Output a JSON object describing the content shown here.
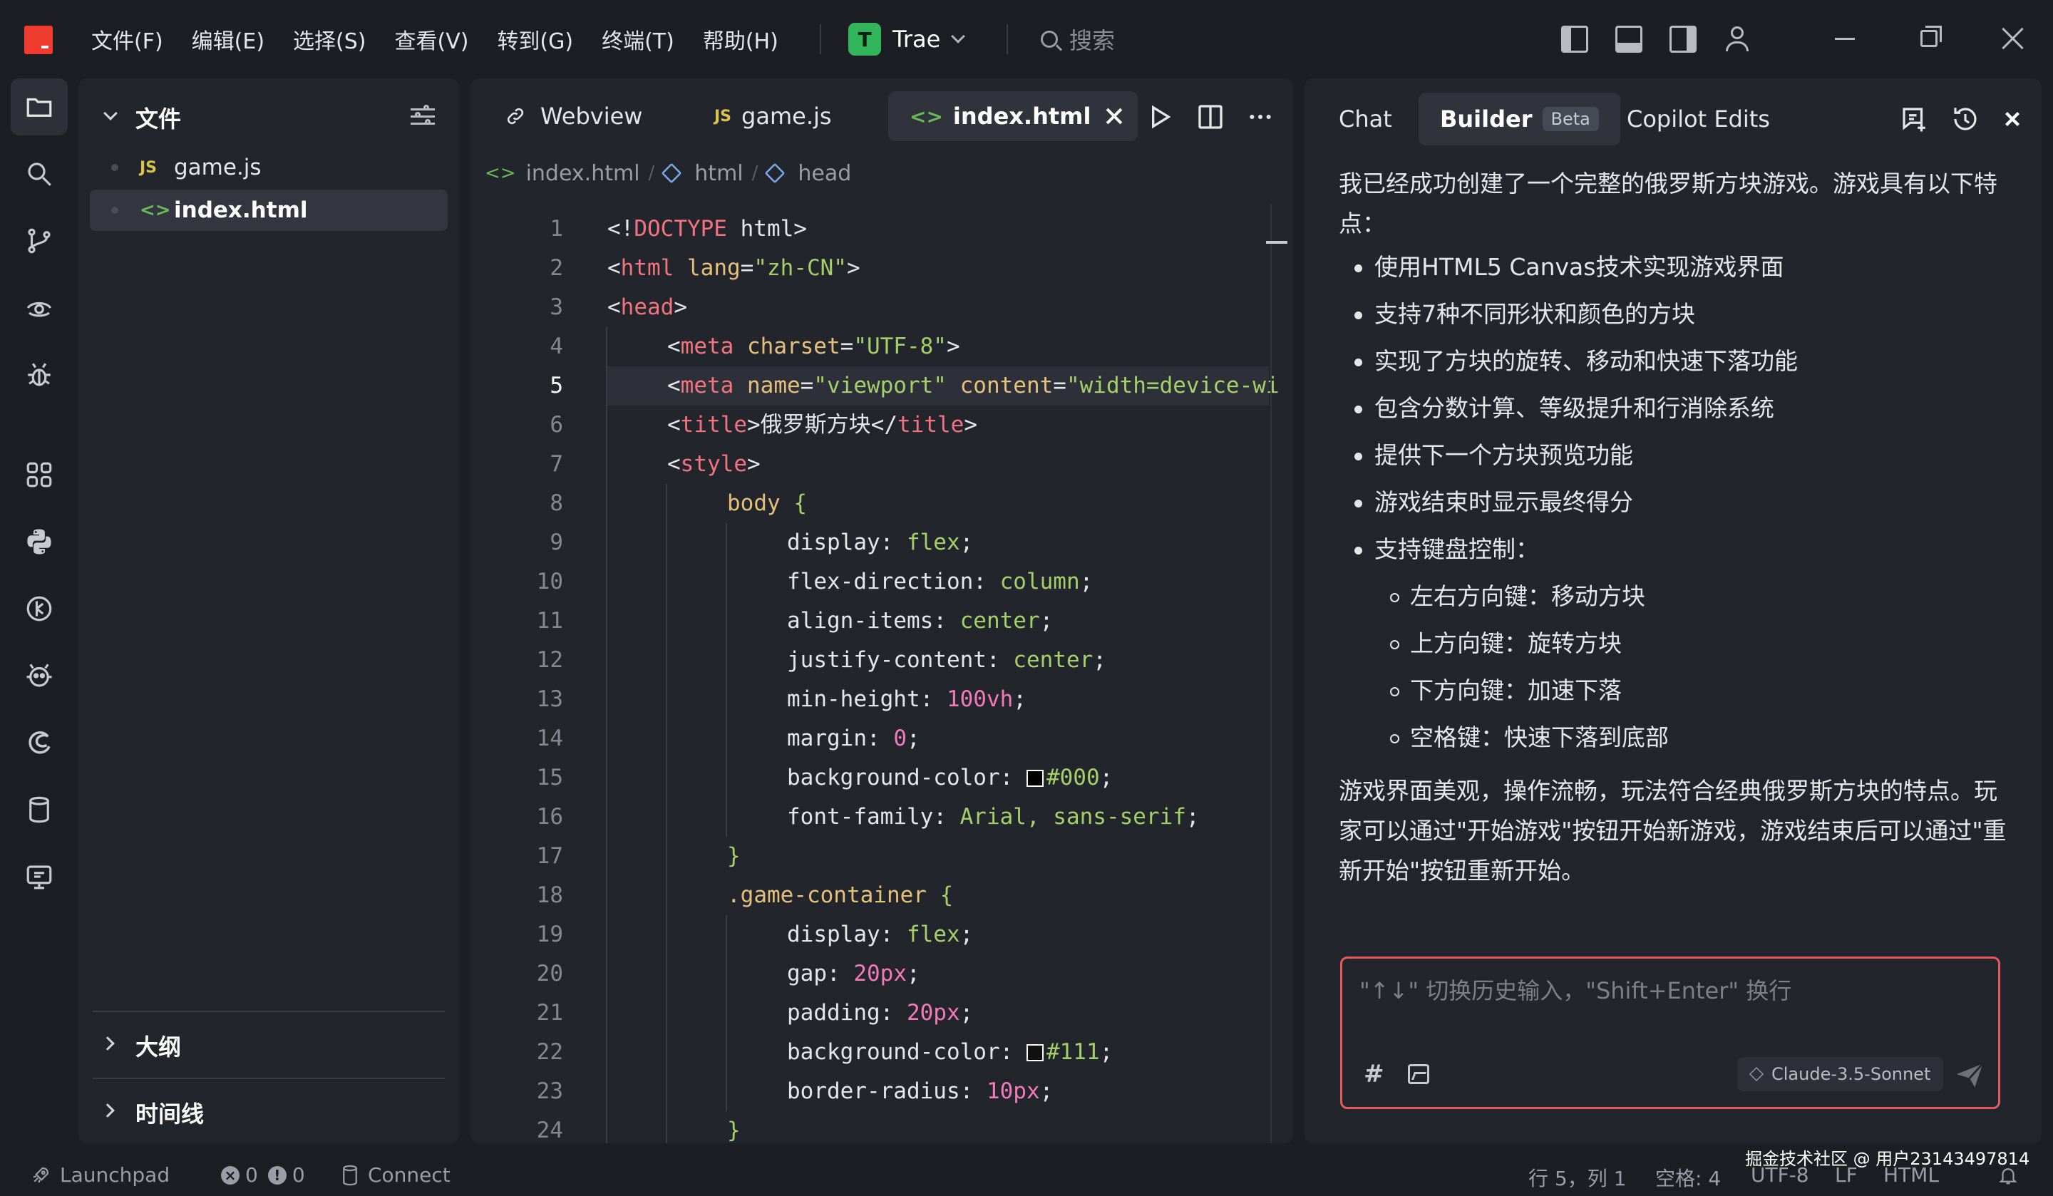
{
  "menus": [
    "文件(F)",
    "编辑(E)",
    "选择(S)",
    "查看(V)",
    "转到(G)",
    "终端(T)",
    "帮助(H)"
  ],
  "brand": {
    "badge": "T",
    "name": "Trae"
  },
  "search": {
    "label": "搜索"
  },
  "explorer": {
    "title": "文件",
    "files": [
      {
        "icon": "JS",
        "name": "game.js",
        "selected": false
      },
      {
        "icon": "<>",
        "name": "index.html",
        "selected": true
      }
    ],
    "sections": [
      "大纲",
      "时间线"
    ]
  },
  "editor": {
    "tabs": [
      {
        "label": "Webview",
        "icon": "webview-icon"
      },
      {
        "label": "game.js",
        "icon": "JS"
      },
      {
        "label": "index.html",
        "icon": "<>",
        "active": true
      }
    ],
    "breadcrumb": [
      "index.html",
      "html",
      "head"
    ],
    "current_line": 5,
    "lines": [
      {
        "n": "1",
        "d": 0,
        "s": [
          [
            "c-punc",
            "<!"
          ],
          [
            "c-tag",
            "DOCTYPE"
          ],
          [
            "c-punc",
            " html>"
          ]
        ]
      },
      {
        "n": "2",
        "d": 0,
        "s": [
          [
            "c-punc",
            "<"
          ],
          [
            "c-tag",
            "html"
          ],
          [
            "c-attr",
            " lang"
          ],
          [
            "c-punc",
            "="
          ],
          [
            "c-str",
            "\"zh-CN\""
          ],
          [
            "c-punc",
            ">"
          ]
        ]
      },
      {
        "n": "3",
        "d": 0,
        "s": [
          [
            "c-punc",
            "<"
          ],
          [
            "c-tag",
            "head"
          ],
          [
            "c-punc",
            ">"
          ]
        ]
      },
      {
        "n": "4",
        "d": 1,
        "s": [
          [
            "c-punc",
            "<"
          ],
          [
            "c-tag",
            "meta"
          ],
          [
            "c-attr",
            " charset"
          ],
          [
            "c-punc",
            "="
          ],
          [
            "c-str",
            "\"UTF-8\""
          ],
          [
            "c-punc",
            ">"
          ]
        ]
      },
      {
        "n": "5",
        "d": 1,
        "s": [
          [
            "c-punc",
            "<"
          ],
          [
            "c-tag",
            "meta"
          ],
          [
            "c-attr",
            " name"
          ],
          [
            "c-punc",
            "="
          ],
          [
            "c-str",
            "\"viewport\""
          ],
          [
            "c-attr",
            " content"
          ],
          [
            "c-punc",
            "="
          ],
          [
            "c-str",
            "\"width=device-wi"
          ]
        ]
      },
      {
        "n": "6",
        "d": 1,
        "s": [
          [
            "c-punc",
            "<"
          ],
          [
            "c-tag",
            "title"
          ],
          [
            "c-punc",
            ">"
          ],
          [
            "c-text",
            "俄罗斯方块"
          ],
          [
            "c-punc",
            "</"
          ],
          [
            "c-tag",
            "title"
          ],
          [
            "c-punc",
            ">"
          ]
        ]
      },
      {
        "n": "7",
        "d": 1,
        "s": [
          [
            "c-punc",
            "<"
          ],
          [
            "c-tag",
            "style"
          ],
          [
            "c-punc",
            ">"
          ]
        ]
      },
      {
        "n": "8",
        "d": 2,
        "s": [
          [
            "c-sel",
            "body"
          ],
          [
            "c-brace",
            " {"
          ]
        ]
      },
      {
        "n": "9",
        "d": 3,
        "s": [
          [
            "c-prop",
            "display"
          ],
          [
            "c-punc",
            ": "
          ],
          [
            "c-val",
            "flex"
          ],
          [
            "c-punc",
            ";"
          ]
        ]
      },
      {
        "n": "10",
        "d": 3,
        "s": [
          [
            "c-prop",
            "flex-direction"
          ],
          [
            "c-punc",
            ": "
          ],
          [
            "c-val",
            "column"
          ],
          [
            "c-punc",
            ";"
          ]
        ]
      },
      {
        "n": "11",
        "d": 3,
        "s": [
          [
            "c-prop",
            "align-items"
          ],
          [
            "c-punc",
            ": "
          ],
          [
            "c-val",
            "center"
          ],
          [
            "c-punc",
            ";"
          ]
        ]
      },
      {
        "n": "12",
        "d": 3,
        "s": [
          [
            "c-prop",
            "justify-content"
          ],
          [
            "c-punc",
            ": "
          ],
          [
            "c-val",
            "center"
          ],
          [
            "c-punc",
            ";"
          ]
        ]
      },
      {
        "n": "13",
        "d": 3,
        "s": [
          [
            "c-prop",
            "min-height"
          ],
          [
            "c-punc",
            ": "
          ],
          [
            "c-num",
            "100vh"
          ],
          [
            "c-punc",
            ";"
          ]
        ]
      },
      {
        "n": "14",
        "d": 3,
        "s": [
          [
            "c-prop",
            "margin"
          ],
          [
            "c-punc",
            ": "
          ],
          [
            "c-num",
            "0"
          ],
          [
            "c-punc",
            ";"
          ]
        ]
      },
      {
        "n": "15",
        "d": 3,
        "s": [
          [
            "c-prop",
            "background-color"
          ],
          [
            "c-punc",
            ": "
          ],
          [
            "swatch",
            "#000000"
          ],
          [
            "c-val",
            "#000"
          ],
          [
            "c-punc",
            ";"
          ]
        ]
      },
      {
        "n": "16",
        "d": 3,
        "s": [
          [
            "c-prop",
            "font-family"
          ],
          [
            "c-punc",
            ": "
          ],
          [
            "c-val",
            "Arial, sans-serif"
          ],
          [
            "c-punc",
            ";"
          ]
        ]
      },
      {
        "n": "17",
        "d": 2,
        "s": [
          [
            "c-brace",
            "}"
          ]
        ]
      },
      {
        "n": "18",
        "d": 2,
        "s": [
          [
            "c-sel",
            ".game-container"
          ],
          [
            "c-brace",
            " {"
          ]
        ]
      },
      {
        "n": "19",
        "d": 3,
        "s": [
          [
            "c-prop",
            "display"
          ],
          [
            "c-punc",
            ": "
          ],
          [
            "c-val",
            "flex"
          ],
          [
            "c-punc",
            ";"
          ]
        ]
      },
      {
        "n": "20",
        "d": 3,
        "s": [
          [
            "c-prop",
            "gap"
          ],
          [
            "c-punc",
            ": "
          ],
          [
            "c-num",
            "20px"
          ],
          [
            "c-punc",
            ";"
          ]
        ]
      },
      {
        "n": "21",
        "d": 3,
        "s": [
          [
            "c-prop",
            "padding"
          ],
          [
            "c-punc",
            ": "
          ],
          [
            "c-num",
            "20px"
          ],
          [
            "c-punc",
            ";"
          ]
        ]
      },
      {
        "n": "22",
        "d": 3,
        "s": [
          [
            "c-prop",
            "background-color"
          ],
          [
            "c-punc",
            ": "
          ],
          [
            "swatch",
            "#111111"
          ],
          [
            "c-val",
            "#111"
          ],
          [
            "c-punc",
            ";"
          ]
        ]
      },
      {
        "n": "23",
        "d": 3,
        "s": [
          [
            "c-prop",
            "border-radius"
          ],
          [
            "c-punc",
            ": "
          ],
          [
            "c-num",
            "10px"
          ],
          [
            "c-punc",
            ";"
          ]
        ]
      },
      {
        "n": "24",
        "d": 2,
        "s": [
          [
            "c-brace",
            "}"
          ]
        ]
      }
    ]
  },
  "chat": {
    "tabs": [
      "Chat",
      "Builder",
      "Copilot Edits"
    ],
    "beta": "Beta",
    "intro": "我已经成功创建了一个完整的俄罗斯方块游戏。游戏具有以下特点：",
    "bullets": [
      "使用HTML5 Canvas技术实现游戏界面",
      "支持7种不同形状和颜色的方块",
      "实现了方块的旋转、移动和快速下落功能",
      "包含分数计算、等级提升和行消除系统",
      "提供下一个方块预览功能",
      "游戏结束时显示最终得分",
      "支持键盘控制："
    ],
    "sub_bullets": [
      "左右方向键：移动方块",
      "上方向键：旋转方块",
      "下方向键：加速下落",
      "空格键：快速下落到底部"
    ],
    "outro": "游戏界面美观，操作流畅，玩法符合经典俄罗斯方块的特点。玩家可以通过\"开始游戏\"按钮开始新游戏，游戏结束后可以通过\"重新开始\"按钮重新开始。",
    "input_placeholder": "\"↑↓\" 切换历史输入，\"Shift+Enter\" 换行",
    "model": "Claude-3.5-Sonnet"
  },
  "status": {
    "launchpad": "Launchpad",
    "errors": "0",
    "warnings": "0",
    "connect": "Connect",
    "cursor": "行 5，列 1",
    "spaces": "空格: 4",
    "encoding": "UTF-8",
    "eol": "LF",
    "language": "HTML"
  },
  "watermark": "掘金技术社区 @ 用户23143497814",
  "colors": {
    "accent_red": "#f03c2e",
    "brand_green": "#32b55a",
    "input_border": "#e35a5a"
  }
}
